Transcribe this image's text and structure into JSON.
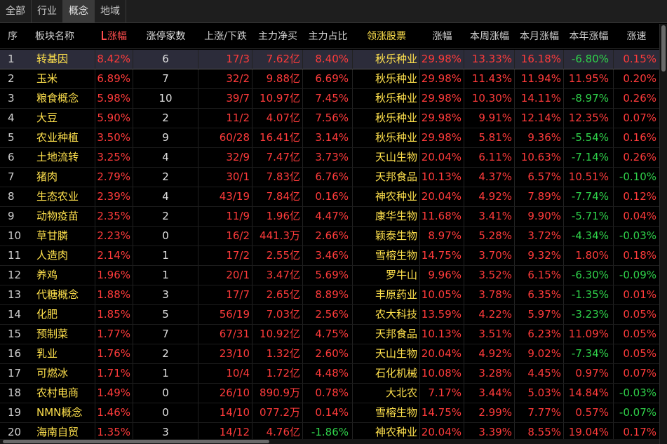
{
  "tabs": [
    "全部",
    "行业",
    "概念",
    "地域"
  ],
  "active_tab": 2,
  "columns": {
    "idx": "序",
    "name": "板块名称",
    "chg": "涨幅",
    "limit": "涨停家数",
    "updown": "上涨/下跌",
    "net": "主力净买",
    "pct": "主力占比",
    "lead": "领涨股票",
    "lead_chg": "涨幅",
    "week": "本周涨幅",
    "month": "本月涨幅",
    "year": "本年涨幅",
    "speed": "涨速"
  },
  "sort_icon": "sort-descending-icon",
  "colors": {
    "up": "#ff3b3b",
    "down": "#2fd14a",
    "name": "#ffe14d",
    "selected_row": "#2c2c3a"
  },
  "rows": [
    {
      "idx": "1",
      "name": "转基因",
      "chg": "8.42%",
      "limit": "6",
      "updown": "17/3",
      "net": "7.62亿",
      "pct": "8.40%",
      "lead": "秋乐种业",
      "lead_chg": "29.98%",
      "week": "13.33%",
      "month": "16.18%",
      "year": "-6.80%",
      "speed": "0.15%"
    },
    {
      "idx": "2",
      "name": "玉米",
      "chg": "6.89%",
      "limit": "7",
      "updown": "32/2",
      "net": "9.88亿",
      "pct": "6.69%",
      "lead": "秋乐种业",
      "lead_chg": "29.98%",
      "week": "11.43%",
      "month": "11.94%",
      "year": "11.95%",
      "speed": "0.20%"
    },
    {
      "idx": "3",
      "name": "粮食概念",
      "chg": "5.98%",
      "limit": "10",
      "updown": "39/7",
      "net": "10.97亿",
      "pct": "7.45%",
      "lead": "秋乐种业",
      "lead_chg": "29.98%",
      "week": "10.30%",
      "month": "14.11%",
      "year": "-8.97%",
      "speed": "0.26%"
    },
    {
      "idx": "4",
      "name": "大豆",
      "chg": "5.90%",
      "limit": "2",
      "updown": "11/2",
      "net": "4.07亿",
      "pct": "7.56%",
      "lead": "秋乐种业",
      "lead_chg": "29.98%",
      "week": "9.91%",
      "month": "12.14%",
      "year": "12.35%",
      "speed": "0.07%"
    },
    {
      "idx": "5",
      "name": "农业种植",
      "chg": "3.50%",
      "limit": "9",
      "updown": "60/28",
      "net": "16.41亿",
      "pct": "3.14%",
      "lead": "秋乐种业",
      "lead_chg": "29.98%",
      "week": "5.81%",
      "month": "9.36%",
      "year": "-5.54%",
      "speed": "0.16%"
    },
    {
      "idx": "6",
      "name": "土地流转",
      "chg": "3.25%",
      "limit": "4",
      "updown": "32/9",
      "net": "7.47亿",
      "pct": "3.73%",
      "lead": "天山生物",
      "lead_chg": "20.04%",
      "week": "6.11%",
      "month": "10.63%",
      "year": "-7.14%",
      "speed": "0.26%"
    },
    {
      "idx": "7",
      "name": "猪肉",
      "chg": "2.79%",
      "limit": "2",
      "updown": "30/1",
      "net": "7.83亿",
      "pct": "6.76%",
      "lead": "天邦食品",
      "lead_chg": "10.13%",
      "week": "4.37%",
      "month": "6.57%",
      "year": "10.51%",
      "speed": "-0.10%"
    },
    {
      "idx": "8",
      "name": "生态农业",
      "chg": "2.39%",
      "limit": "4",
      "updown": "43/19",
      "net": "7.84亿",
      "pct": "0.16%",
      "lead": "神农种业",
      "lead_chg": "20.04%",
      "week": "4.92%",
      "month": "7.89%",
      "year": "-7.74%",
      "speed": "0.12%"
    },
    {
      "idx": "9",
      "name": "动物疫苗",
      "chg": "2.35%",
      "limit": "2",
      "updown": "11/9",
      "net": "1.96亿",
      "pct": "4.47%",
      "lead": "康华生物",
      "lead_chg": "11.68%",
      "week": "3.41%",
      "month": "9.90%",
      "year": "-5.71%",
      "speed": "0.04%"
    },
    {
      "idx": "10",
      "name": "草甘膦",
      "chg": "2.23%",
      "limit": "0",
      "updown": "16/2",
      "net": "441.3万",
      "pct": "2.66%",
      "lead": "颖泰生物",
      "lead_chg": "8.97%",
      "week": "5.28%",
      "month": "3.72%",
      "year": "-4.34%",
      "speed": "-0.03%"
    },
    {
      "idx": "11",
      "name": "人造肉",
      "chg": "2.14%",
      "limit": "1",
      "updown": "17/2",
      "net": "2.55亿",
      "pct": "3.46%",
      "lead": "雪榕生物",
      "lead_chg": "14.75%",
      "week": "3.70%",
      "month": "9.32%",
      "year": "1.80%",
      "speed": "0.18%"
    },
    {
      "idx": "12",
      "name": "养鸡",
      "chg": "1.96%",
      "limit": "1",
      "updown": "20/1",
      "net": "3.47亿",
      "pct": "5.69%",
      "lead": "罗牛山",
      "lead_chg": "9.96%",
      "week": "3.52%",
      "month": "6.15%",
      "year": "-6.30%",
      "speed": "-0.09%"
    },
    {
      "idx": "13",
      "name": "代糖概念",
      "chg": "1.88%",
      "limit": "3",
      "updown": "17/7",
      "net": "2.65亿",
      "pct": "8.89%",
      "lead": "丰原药业",
      "lead_chg": "10.05%",
      "week": "3.78%",
      "month": "6.35%",
      "year": "-1.35%",
      "speed": "0.01%"
    },
    {
      "idx": "14",
      "name": "化肥",
      "chg": "1.85%",
      "limit": "5",
      "updown": "56/19",
      "net": "7.03亿",
      "pct": "2.56%",
      "lead": "农大科技",
      "lead_chg": "13.59%",
      "week": "4.22%",
      "month": "5.97%",
      "year": "-3.23%",
      "speed": "0.05%"
    },
    {
      "idx": "15",
      "name": "预制菜",
      "chg": "1.77%",
      "limit": "7",
      "updown": "67/31",
      "net": "10.92亿",
      "pct": "4.75%",
      "lead": "天邦食品",
      "lead_chg": "10.13%",
      "week": "3.51%",
      "month": "6.23%",
      "year": "11.09%",
      "speed": "0.05%"
    },
    {
      "idx": "16",
      "name": "乳业",
      "chg": "1.76%",
      "limit": "2",
      "updown": "23/10",
      "net": "1.32亿",
      "pct": "2.60%",
      "lead": "天山生物",
      "lead_chg": "20.04%",
      "week": "4.92%",
      "month": "9.02%",
      "year": "-7.34%",
      "speed": "0.05%"
    },
    {
      "idx": "17",
      "name": "可燃冰",
      "chg": "1.71%",
      "limit": "1",
      "updown": "10/4",
      "net": "1.72亿",
      "pct": "4.48%",
      "lead": "石化机械",
      "lead_chg": "10.08%",
      "week": "3.28%",
      "month": "4.45%",
      "year": "0.97%",
      "speed": "0.07%"
    },
    {
      "idx": "18",
      "name": "农村电商",
      "chg": "1.49%",
      "limit": "0",
      "updown": "26/10",
      "net": "890.9万",
      "pct": "0.78%",
      "lead": "大北农",
      "lead_chg": "7.17%",
      "week": "3.44%",
      "month": "5.03%",
      "year": "14.84%",
      "speed": "-0.03%"
    },
    {
      "idx": "19",
      "name": "NMN概念",
      "chg": "1.46%",
      "limit": "0",
      "updown": "14/10",
      "net": "077.2万",
      "pct": "0.14%",
      "lead": "雪榕生物",
      "lead_chg": "14.75%",
      "week": "2.99%",
      "month": "7.77%",
      "year": "0.57%",
      "speed": "-0.07%"
    },
    {
      "idx": "20",
      "name": "海南自贸",
      "chg": "1.35%",
      "limit": "3",
      "updown": "14/12",
      "net": "4.76亿",
      "pct": "-1.86%",
      "lead": "神农种业",
      "lead_chg": "20.04%",
      "week": "3.39%",
      "month": "8.55%",
      "year": "19.04%",
      "speed": "0.17%"
    }
  ]
}
